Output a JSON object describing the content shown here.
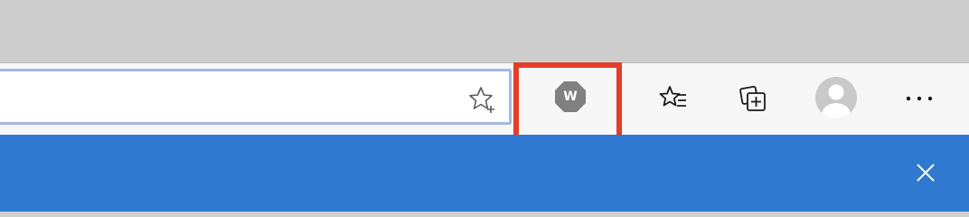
{
  "toolbar": {
    "address_input_value": "",
    "extension": {
      "letter": "W",
      "icon": "octagon-w-icon",
      "color": "#808080"
    },
    "icons": {
      "add_favorite": "star-plus-icon",
      "favorites": "favorites-star-list-icon",
      "collections": "collections-icon",
      "profile": "profile-avatar-icon",
      "more": "ellipsis-icon"
    },
    "highlight_color": "#e43d2a"
  },
  "info_bar": {
    "color": "#2f79d0",
    "close_icon": "close-icon"
  }
}
